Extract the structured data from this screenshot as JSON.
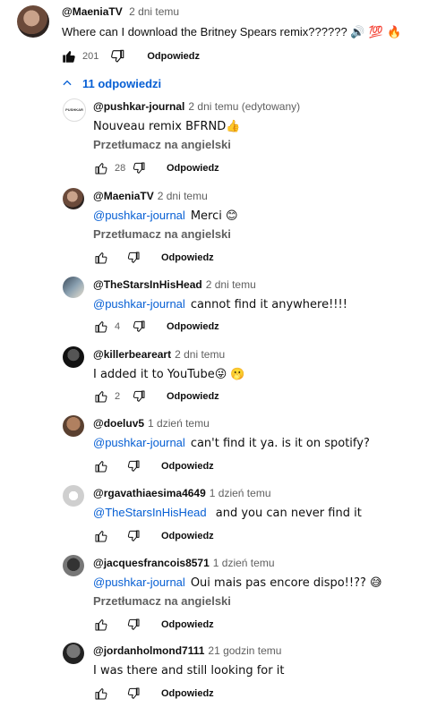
{
  "main_comment": {
    "handle": "@MaeniaTV",
    "time": "2 dni temu",
    "text": "Where can I download the Britney Spears remix??????",
    "emojis": "🔊 💯 🔥",
    "likes": "201",
    "reply_label": "Odpowiedz"
  },
  "replies_toggle": {
    "label": "11 odpowiedzi",
    "icon": "chevron-up-icon"
  },
  "replies": [
    {
      "handle": "@pushkar-journal",
      "time": "2 dni temu (edytowany)",
      "mention": "",
      "text": "Nouveau remix BFRND👍",
      "translate": "Przetłumacz na angielski",
      "likes": "28",
      "reply_label": "Odpowiedz",
      "avatar_text": "PUSHKAR"
    },
    {
      "handle": "@MaeniaTV",
      "time": "2 dni temu",
      "mention": "@pushkar-journal",
      "text": "Merci 😊",
      "translate": "Przetłumacz na angielski",
      "likes": "",
      "reply_label": "Odpowiedz",
      "avatar_text": ""
    },
    {
      "handle": "@TheStarsInHisHead",
      "time": "2 dni temu",
      "mention": "@pushkar-journal",
      "text": "cannot find it anywhere!!!!",
      "translate": "",
      "likes": "4",
      "reply_label": "Odpowiedz",
      "avatar_text": ""
    },
    {
      "handle": "@killerbeareart",
      "time": "2 dni temu",
      "mention": "",
      "text": "I added it to YouTube😜 🫢",
      "translate": "",
      "likes": "2",
      "reply_label": "Odpowiedz",
      "avatar_text": ""
    },
    {
      "handle": "@doeluv5",
      "time": "1 dzień temu",
      "mention": "@pushkar-journal",
      "text": "can't find it ya. is it on spotify?",
      "translate": "",
      "likes": "",
      "reply_label": "Odpowiedz",
      "avatar_text": ""
    },
    {
      "handle": "@rgavathiaesima4649",
      "time": "1 dzień temu",
      "mention": "@TheStarsInHisHead",
      "text": " and you can never find it",
      "translate": "",
      "likes": "",
      "reply_label": "Odpowiedz",
      "avatar_text": ""
    },
    {
      "handle": "@jacquesfrancois8571",
      "time": "1 dzień temu",
      "mention": "@pushkar-journal",
      "text": "Oui mais pas encore dispo!!?? 😅",
      "translate": "Przetłumacz na angielski",
      "likes": "",
      "reply_label": "Odpowiedz",
      "avatar_text": ""
    },
    {
      "handle": "@jordanholmond7111",
      "time": "21 godzin temu",
      "mention": "",
      "text": "I was there and still looking for it",
      "translate": "",
      "likes": "",
      "reply_label": "Odpowiedz",
      "avatar_text": ""
    }
  ],
  "colors": {
    "link": "#065fd4",
    "muted": "#606060",
    "text": "#0f0f0f"
  }
}
